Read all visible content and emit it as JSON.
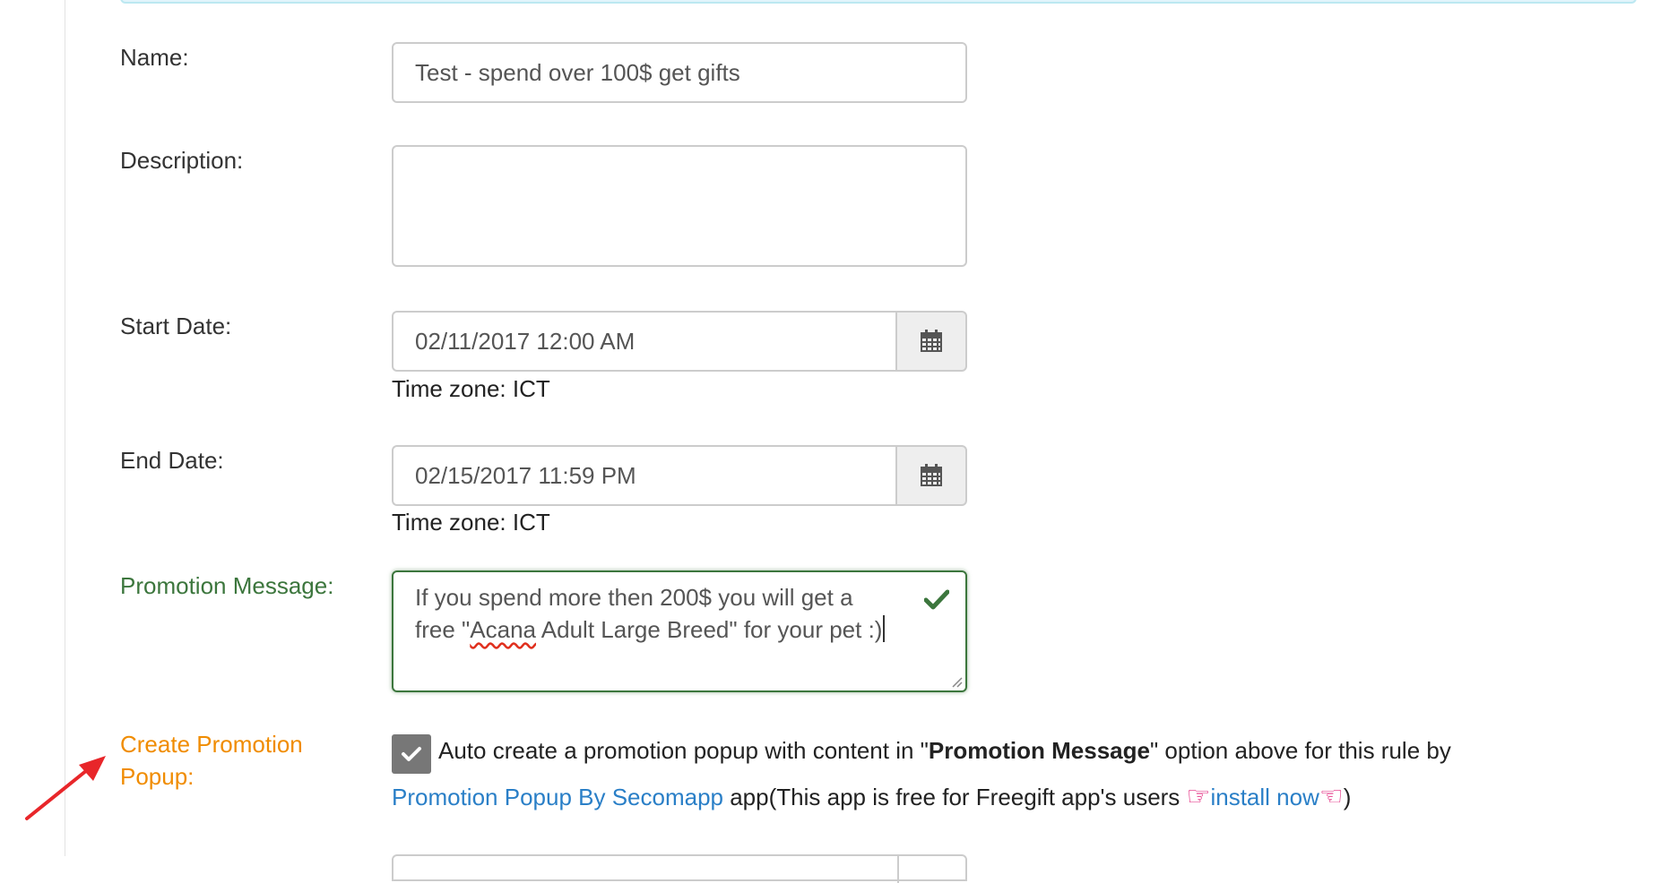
{
  "form": {
    "name": {
      "label": "Name:",
      "value": "Test - spend over 100$ get gifts"
    },
    "description": {
      "label": "Description:",
      "value": ""
    },
    "start_date": {
      "label": "Start Date:",
      "value": "02/11/2017 12:00 AM",
      "timezone": "Time zone: ICT"
    },
    "end_date": {
      "label": "End Date:",
      "value": "02/15/2017 11:59 PM",
      "timezone": "Time zone: ICT"
    },
    "promotion_message": {
      "label": "Promotion Message:",
      "line1": "If you spend more then 200$ you will get a",
      "line2_pre": "free \"",
      "line2_misspelled": "Acana",
      "line2_post": " Adult Large Breed\" for your pet :)"
    },
    "create_popup": {
      "label_line1": "Create Promotion",
      "label_line2": "Popup:",
      "checked": true,
      "desc_pre": "Auto create a promotion popup with content in \"",
      "desc_bold": "Promotion Message",
      "desc_post": "\" option above for this rule by",
      "app_link": "Promotion Popup By Secomapp",
      "app_note": " app(This app is free for Freegift app's users ",
      "install_link": "install now",
      "close_paren": ")"
    }
  },
  "icons": {
    "calendar": "calendar-icon",
    "valid": "checkmark-icon",
    "hand_right": "☞",
    "hand_left": "☜"
  },
  "colors": {
    "success": "#3c763d",
    "warning": "#f08c00",
    "link": "#2a7fc7",
    "hand": "#e2227b",
    "annotation_arrow": "#e8262a"
  }
}
